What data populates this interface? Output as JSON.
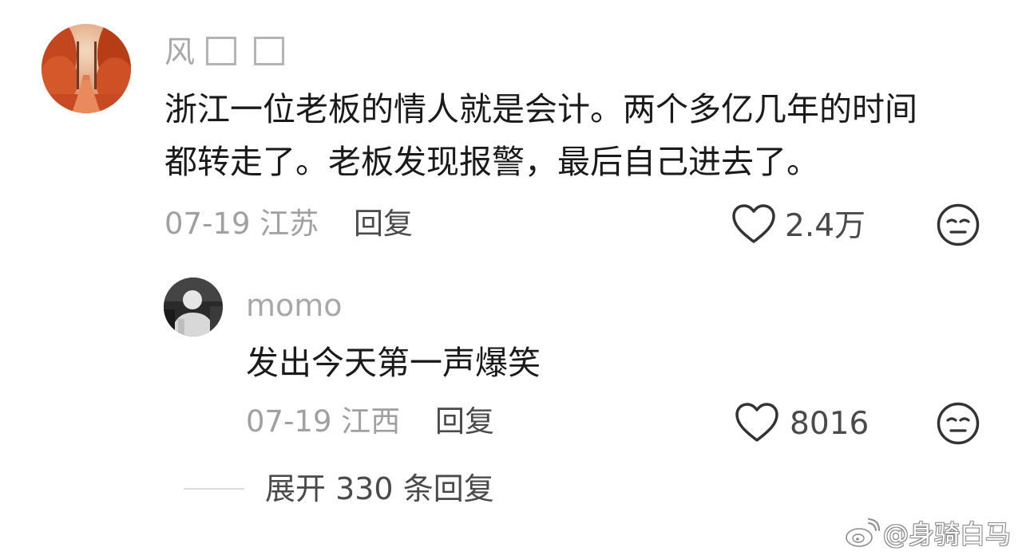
{
  "main_comment": {
    "username": "风",
    "text_line1": "浙江一位老板的情人就是会计。两个多亿几年的时间",
    "text_line2": "都转走了。老板发现报警，最后自己进去了。",
    "date_location": "07-19 江苏",
    "reply_label": "回复",
    "like_count": "2.4万"
  },
  "reply_comment": {
    "username": "momo",
    "text": "发出今天第一声爆笑",
    "date_location": "07-19 江西",
    "reply_label": "回复",
    "like_count": "8016"
  },
  "expand_replies_label": "展开 330 条回复",
  "watermark": {
    "text": "@身骑白马",
    "icon": "weibo-logo"
  },
  "colors": {
    "username": "#a8a8a8",
    "text": "#1a1a1a",
    "meta": "#a0a0a0",
    "action": "#4a4a4a"
  }
}
